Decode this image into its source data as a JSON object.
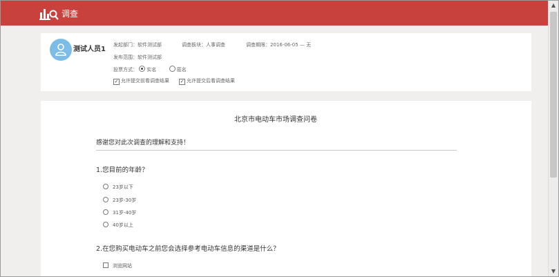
{
  "header": {
    "title": "调查",
    "logo_icon": "chart-search-icon",
    "bg_color": "#c9413d"
  },
  "profile": {
    "name": "测试人员1",
    "avatar_icon": "user-avatar-icon",
    "dept_label": "发起部门：",
    "dept_value": "软件测试部",
    "section_label": "调查板块：",
    "section_value": "人事调查",
    "period_label": "调查期限：",
    "period_value": "2016-06-05 — 无",
    "scope_label": "发布范围：",
    "scope_value": "软件测试部",
    "vote_label": "投票方式：",
    "vote_options": [
      "实名",
      "匿名"
    ],
    "vote_selected": "实名",
    "checkbox_before": "允许提交前看调查结果",
    "checkbox_after": "允许提交后看调查结果"
  },
  "survey": {
    "title": "北京市电动车市场调查问卷",
    "intro": "感谢您对此次调查的理解和支持！",
    "questions": [
      {
        "title": "1.您目前的年龄？",
        "type": "radio",
        "options": [
          "23岁以下",
          "23岁-30岁",
          "31岁-40岁",
          "40岁以上"
        ]
      },
      {
        "title": "2.在您购买电动车之前您会选择参考电动车信息的渠道是什么？",
        "type": "checkbox",
        "options": [
          "浏览网站"
        ]
      }
    ]
  }
}
